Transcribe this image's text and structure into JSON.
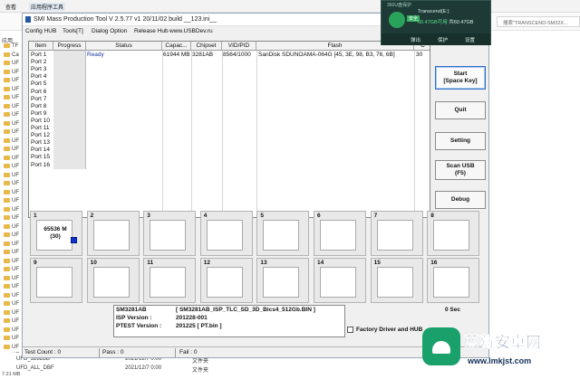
{
  "explorer": {
    "tabs": [
      "查看",
      "应用程序工具"
    ],
    "back": "← → ↑",
    "search_placeholder": "搜索\"TRANSCEND-SM32X...",
    "nav_label": "应用",
    "nav_items": [
      "TF",
      "Ca",
      "UF",
      "UF",
      "UF",
      "UF",
      "UF",
      "UF",
      "UF",
      "UF",
      "UF",
      "UF",
      "UF",
      "UF",
      "UF",
      "UF",
      "UF",
      "UF",
      "UF",
      "UF",
      "UF",
      "UF",
      "UF",
      "UF",
      "UF",
      "UF",
      "UF",
      "UF",
      "UF",
      "UF",
      "UF",
      "UF",
      "UF",
      "UF",
      "UF",
      "UF",
      "UF"
    ],
    "rows": [
      {
        "name": "UFD_3282BB",
        "date": "2021/12/7 0:00",
        "type": "文件夹"
      },
      {
        "name": "UFD_ALL_DBF",
        "date": "2021/12/7 0:00",
        "type": "文件夹"
      }
    ],
    "status": "7.21 MB"
  },
  "smi": {
    "title": "SMI Mass Production Tool         V 2.5.77    v1        20/11/02 build         __123.ini__",
    "menu": [
      "Config HUB",
      "Tools[T]",
      "Dialog Option",
      "Release Hub",
      "www.USBDev.ru"
    ],
    "columns": [
      "Item",
      "Progress",
      "Status",
      "Capac...",
      "Chipset",
      "VID/PID",
      "Flash",
      "C"
    ],
    "ports": [
      {
        "item": "Port 1",
        "status": "Ready",
        "capacity": "61944 MB",
        "chipset": "3281AB",
        "vidpid": "8564/1000",
        "flash": "SanDisk SDUNOAMA-064G [45, 3E, 98, B3, 76, 6B]",
        "extra": "30"
      },
      {
        "item": "Port 2"
      },
      {
        "item": "Port 3"
      },
      {
        "item": "Port 4"
      },
      {
        "item": "Port 5"
      },
      {
        "item": "Port 6"
      },
      {
        "item": "Port 7"
      },
      {
        "item": "Port 8"
      },
      {
        "item": "Port 9"
      },
      {
        "item": "Port 10"
      },
      {
        "item": "Port 11"
      },
      {
        "item": "Port 12"
      },
      {
        "item": "Port 13"
      },
      {
        "item": "Port 14"
      },
      {
        "item": "Port 15"
      },
      {
        "item": "Port 16"
      }
    ],
    "buttons": {
      "start_l1": "Start",
      "start_l2": "[Space Key]",
      "quit": "Quit",
      "setting": "Setting",
      "scan_l1": "Scan USB",
      "scan_l2": "(F5)",
      "debug": "Debug"
    },
    "port_boxes": [
      "1",
      "2",
      "3",
      "4",
      "5",
      "6",
      "7",
      "8",
      "9",
      "10",
      "11",
      "12",
      "13",
      "14",
      "15",
      "16"
    ],
    "port1_capacity_l1": "65536 M",
    "port1_capacity_l2": "(30)",
    "info": {
      "controller": "SM3281AB",
      "controller_detail": "[ SM3281AB_ISP_TLC_SD_3D_Bics4_512Gb.BIN ]",
      "isp_label": "ISP Version :",
      "isp_value": "201228-001",
      "ptest_label": "PTEST Version :",
      "ptest_value": "201225 [ PT.bin ]"
    },
    "elapsed": "0 Sec",
    "factory_label": "Factory Driver and HUB",
    "status_bar": {
      "test": "Test Count : 0",
      "pass": "Pass : 0",
      "fail": "Fail : 0"
    }
  },
  "security_popup": {
    "title": "360U盘保护",
    "badge": "安全",
    "device": "Transcend(E:)",
    "capacity_used": "60.47GB可用",
    "capacity_total": "共60.47GB",
    "actions": [
      "弹出",
      "保护",
      "设置"
    ]
  },
  "watermark": {
    "title": "蓝莓安卓网",
    "url": "www.lmkjst.com"
  }
}
